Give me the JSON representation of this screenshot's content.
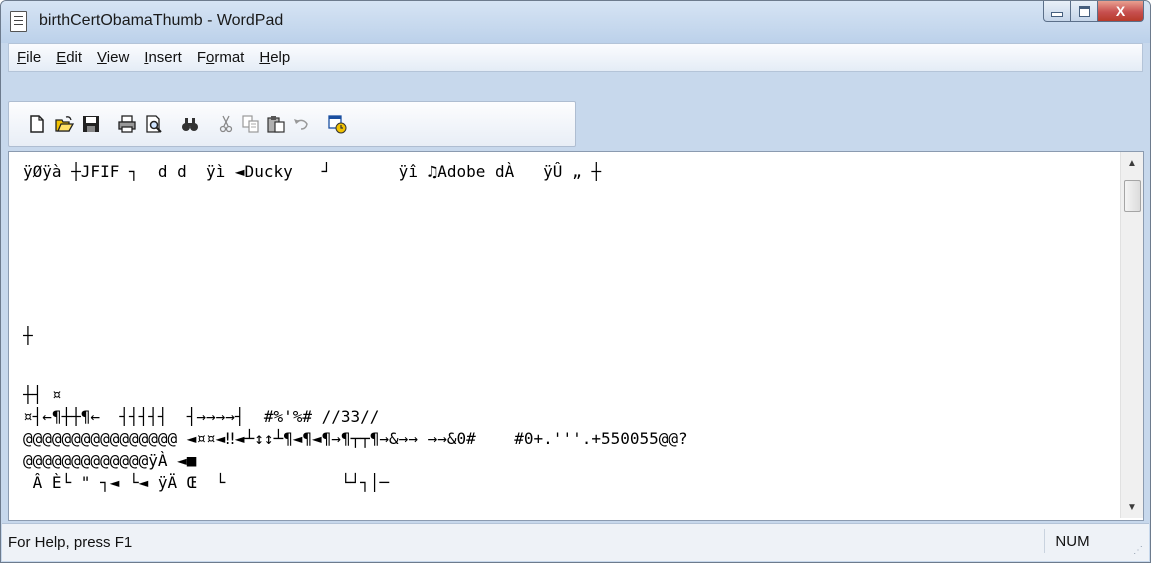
{
  "window": {
    "title": "birthCertObamaThumb - WordPad",
    "close_symbol": "X"
  },
  "menu": {
    "items": [
      {
        "key": "F",
        "rest": "ile"
      },
      {
        "key": "E",
        "rest": "dit"
      },
      {
        "key": "V",
        "rest": "iew"
      },
      {
        "key": "I",
        "rest": "nsert"
      },
      {
        "pre": "F",
        "key": "o",
        "rest": "rmat"
      },
      {
        "key": "H",
        "rest": "elp"
      }
    ]
  },
  "toolbar": {
    "buttons": [
      {
        "name": "new-icon"
      },
      {
        "name": "open-icon"
      },
      {
        "name": "save-icon"
      },
      {
        "name": "print-icon"
      },
      {
        "name": "print-preview-icon"
      },
      {
        "name": "find-icon"
      },
      {
        "name": "cut-icon"
      },
      {
        "name": "copy-icon"
      },
      {
        "name": "paste-icon"
      },
      {
        "name": "undo-icon"
      },
      {
        "name": "date-time-icon"
      }
    ]
  },
  "document": {
    "lines": [
      "ÿØÿà ┼JFIF ┐  d d  ÿì ◄Ducky   ┘       ÿî ♫Adobe dÀ   ÿÛ „ ┼",
      "",
      "",
      "",
      "",
      "",
      "┼",
      "",
      "┼┤ ¤",
      "¤┤←¶┼┼¶←  ┤┤┤┤┤  ┤→→→→┤  #%'%# //33//",
      "@@@@@@@@@@@@@@@@ ◄¤¤◄‼◄┴↕↕┴¶◄¶◄¶→¶┬┬¶→&→→ →→&0#    #0+.'''.+550055@@?",
      "@@@@@@@@@@@@@ÿÀ ◄■",
      " Â È└ \" ┐◄ └◄ ÿÄ Œ  └            └┘┐│─"
    ]
  },
  "status": {
    "help_text": "For Help, press F1",
    "num_lock": "NUM"
  }
}
